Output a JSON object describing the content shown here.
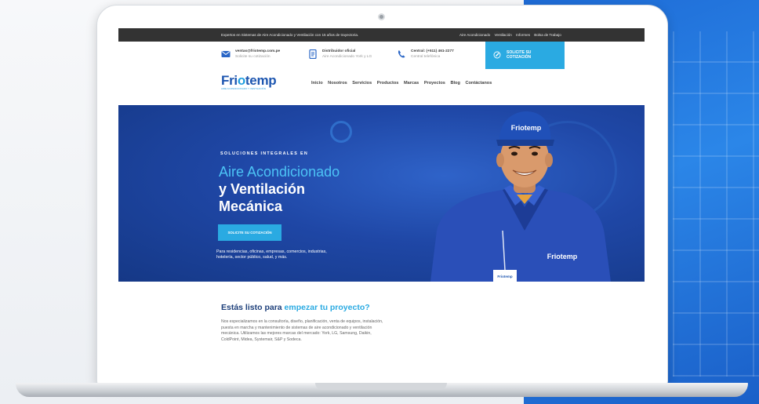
{
  "colors": {
    "brand_dark": "#1d56b0",
    "accent": "#2aaae2",
    "topbar": "#333333",
    "hero": "#1f47a6"
  },
  "topbar": {
    "tagline": "Expertos en Sistemas de Aire Acondicionado y Ventilación con 15 años de trayectoria.",
    "links": [
      "Aire Acondicionado",
      "Ventilación",
      "Informes",
      "Bolsa de Trabajo"
    ]
  },
  "contact": {
    "email": {
      "title": "ventas@friotemp.com.pe",
      "subtitle": "Solicite su cotización",
      "icon": "mail-icon"
    },
    "distributor": {
      "title": "Distribuidor oficial",
      "subtitle": "Aire Acondicionado York y LG",
      "icon": "document-icon"
    },
    "phone": {
      "title": "Central: (+511) 461-2277",
      "subtitle": "Central telefónica",
      "icon": "phone-icon"
    },
    "cta": {
      "label": "SOLICITE SU COTIZACIÓN",
      "icon": "edit-icon"
    }
  },
  "brand": {
    "name_part1": "Fri",
    "name_o": "o",
    "name_part2": "temp",
    "tagline": "AIRE ACONDICIONADO Y VENTILACIÓN"
  },
  "nav": [
    "Inicio",
    "Nosotros",
    "Servicios",
    "Productos",
    "Marcas",
    "Proyectos",
    "Blog",
    "Contáctanos"
  ],
  "hero": {
    "kicker": "SOLUCIONES INTEGRALES EN",
    "line1": "Aire Acondicionado",
    "line2": "y Ventilación",
    "line3": "Mecánica",
    "button": "SOLICITE SU COTIZACIÓN",
    "subtitle": "Para residencias, oficinas, empresas, comercios, industrias, hotelería, sector público, salud, y más.",
    "cap_logo": "Friotemp",
    "shirt_logo": "Friotemp",
    "badge": "Friotemp"
  },
  "intro": {
    "heading_plain": "Estás listo para ",
    "heading_highlight": "empezar tu proyecto?",
    "body": "Nos especializamos en la consultoría, diseño, planificación, venta de equipos, instalación, puesta en marcha y mantenimiento de sistemas de aire acondicionado y ventilación mecánica. Utilizamos las mejores marcas del mercado: York, LG, Samsung, Daikin, ColdPoint, Midea, Systemair, S&P y Sodeca."
  }
}
